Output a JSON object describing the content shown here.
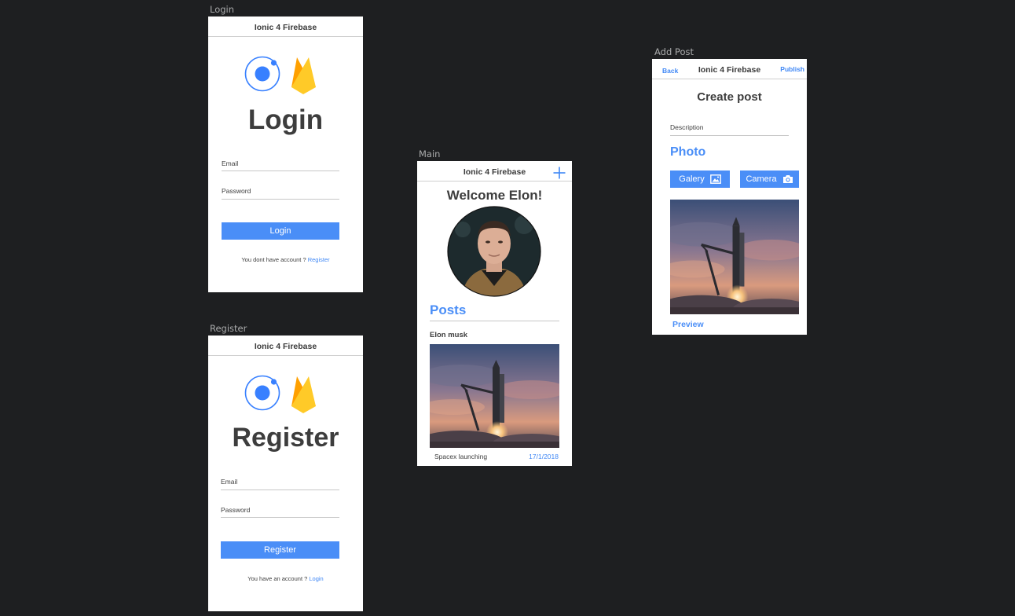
{
  "artboards": {
    "login": "Login",
    "register": "Register",
    "main": "Main",
    "add_post": "Add Post"
  },
  "app_title": "Ionic 4 Firebase",
  "login": {
    "heading": "Login",
    "email_label": "Email",
    "password_label": "Password",
    "button": "Login",
    "footer_text": "You dont have account ? ",
    "footer_link": "Register"
  },
  "register": {
    "heading": "Register",
    "email_label": "Email",
    "password_label": "Password",
    "button": "Register",
    "footer_text": "You have an account ? ",
    "footer_link": "Login"
  },
  "main": {
    "welcome": "Welcome Elon!",
    "posts_heading": "Posts",
    "post": {
      "author": "Elon musk",
      "caption": "Spacex launching",
      "date": "17/1/2018"
    },
    "icons": {
      "add": "plus-icon",
      "avatar": "avatar-photo"
    }
  },
  "add_post": {
    "back": "Back",
    "publish": "Publish",
    "heading": "Create post",
    "description_label": "Description",
    "photo_heading": "Photo",
    "gallery_button": "Galery",
    "camera_button": "Camera",
    "preview": "Preview",
    "icons": {
      "gallery": "image-icon",
      "camera": "camera-icon"
    }
  },
  "colors": {
    "accent": "#4a8ef7",
    "canvas": "#1e1f21",
    "ionic_blue": "#3880ff",
    "firebase_yellow": "#ffca28",
    "firebase_orange": "#f57c00"
  }
}
